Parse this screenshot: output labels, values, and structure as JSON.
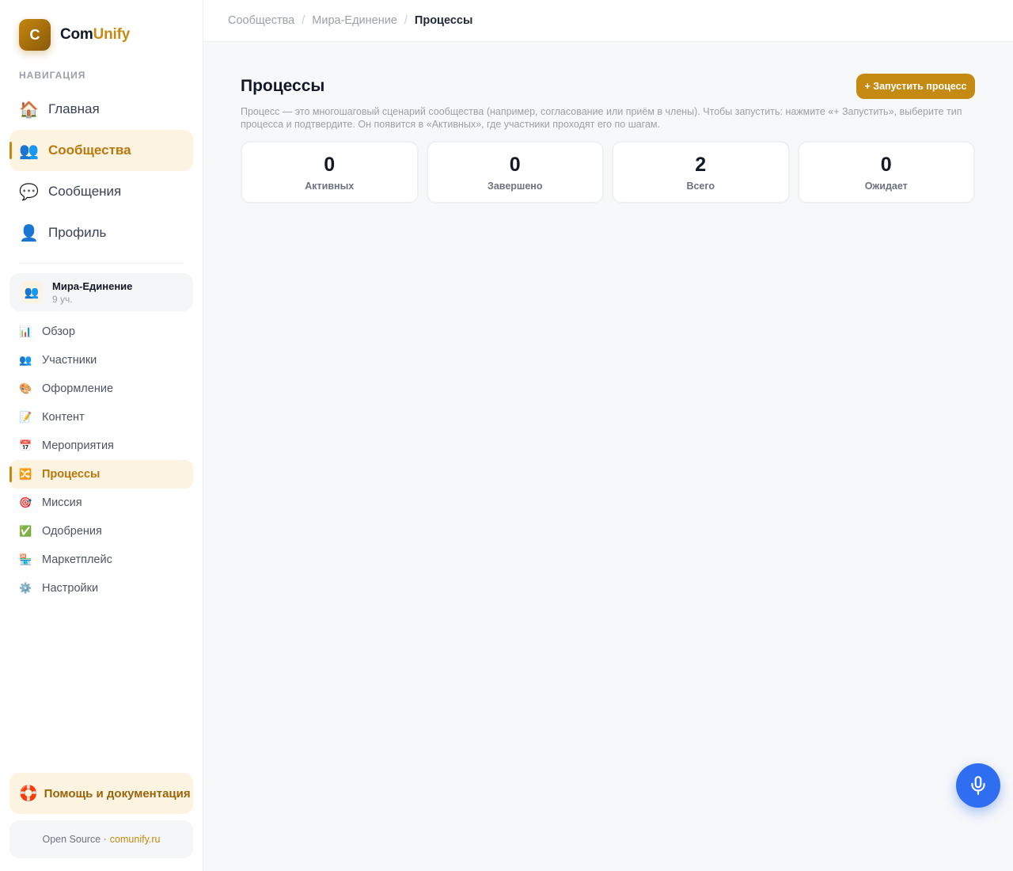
{
  "brand": {
    "logo_letter": "C",
    "name_part1": "Com",
    "name_part2": "Unify"
  },
  "sidebar": {
    "nav_caption": "НАВИГАЦИЯ",
    "main_nav": [
      {
        "icon": "home-icon",
        "glyph": "🏠",
        "label": "Главная",
        "active": false
      },
      {
        "icon": "people-icon",
        "glyph": "👥",
        "label": "Сообщества",
        "active": true
      },
      {
        "icon": "chat-icon",
        "glyph": "💬",
        "label": "Сообщения",
        "active": false
      },
      {
        "icon": "person-icon",
        "glyph": "👤",
        "label": "Профиль",
        "active": false
      }
    ],
    "community": {
      "avatar_glyph": "👥",
      "name": "Мира-Единение",
      "meta": "9 уч."
    },
    "sub_nav": [
      {
        "icon": "chart-icon",
        "glyph": "📊",
        "label": "Обзор",
        "active": false
      },
      {
        "icon": "people-icon",
        "glyph": "👥",
        "label": "Участники",
        "active": false
      },
      {
        "icon": "palette-icon",
        "glyph": "🎨",
        "label": "Оформление",
        "active": false
      },
      {
        "icon": "memo-icon",
        "glyph": "📝",
        "label": "Контент",
        "active": false
      },
      {
        "icon": "calendar-icon",
        "glyph": "📅",
        "label": "Мероприятия",
        "active": false
      },
      {
        "icon": "shuffle-icon",
        "glyph": "🔀",
        "label": "Процессы",
        "active": true
      },
      {
        "icon": "target-icon",
        "glyph": "🎯",
        "label": "Миссия",
        "active": false
      },
      {
        "icon": "check-icon",
        "glyph": "✅",
        "label": "Одобрения",
        "active": false
      },
      {
        "icon": "store-icon",
        "glyph": "🏪",
        "label": "Маркетплейс",
        "active": false
      },
      {
        "icon": "gear-icon",
        "glyph": "⚙️",
        "label": "Настройки",
        "active": false
      }
    ],
    "help": {
      "glyph": "🛟",
      "label": "Помощь и документация"
    },
    "footer": {
      "prefix": "Open Source ·",
      "link": "comunify.ru"
    }
  },
  "breadcrumb": {
    "items": [
      "Сообщества",
      "Мира-Единение",
      "Процессы"
    ],
    "separator": "/"
  },
  "page": {
    "title": "Процессы",
    "start_button": "+ Запустить процесс",
    "description": "Процесс — это многошаговый сценарий сообщества (например, согласование или приём в члены). Чтобы запустить: нажмите «+ Запустить», выберите тип процесса и подтвердите. Он появится в «Активных», где участники проходят его по шагам."
  },
  "stats": [
    {
      "value": "0",
      "label": "Активных"
    },
    {
      "value": "0",
      "label": "Завершено"
    },
    {
      "value": "2",
      "label": "Всего"
    },
    {
      "value": "0",
      "label": "Ожидает"
    }
  ],
  "colors": {
    "accent": "#c58a12",
    "accent_bg": "#fdf3e1",
    "mic": "#2f6ef0"
  },
  "mic_button": {
    "icon": "microphone-icon"
  }
}
